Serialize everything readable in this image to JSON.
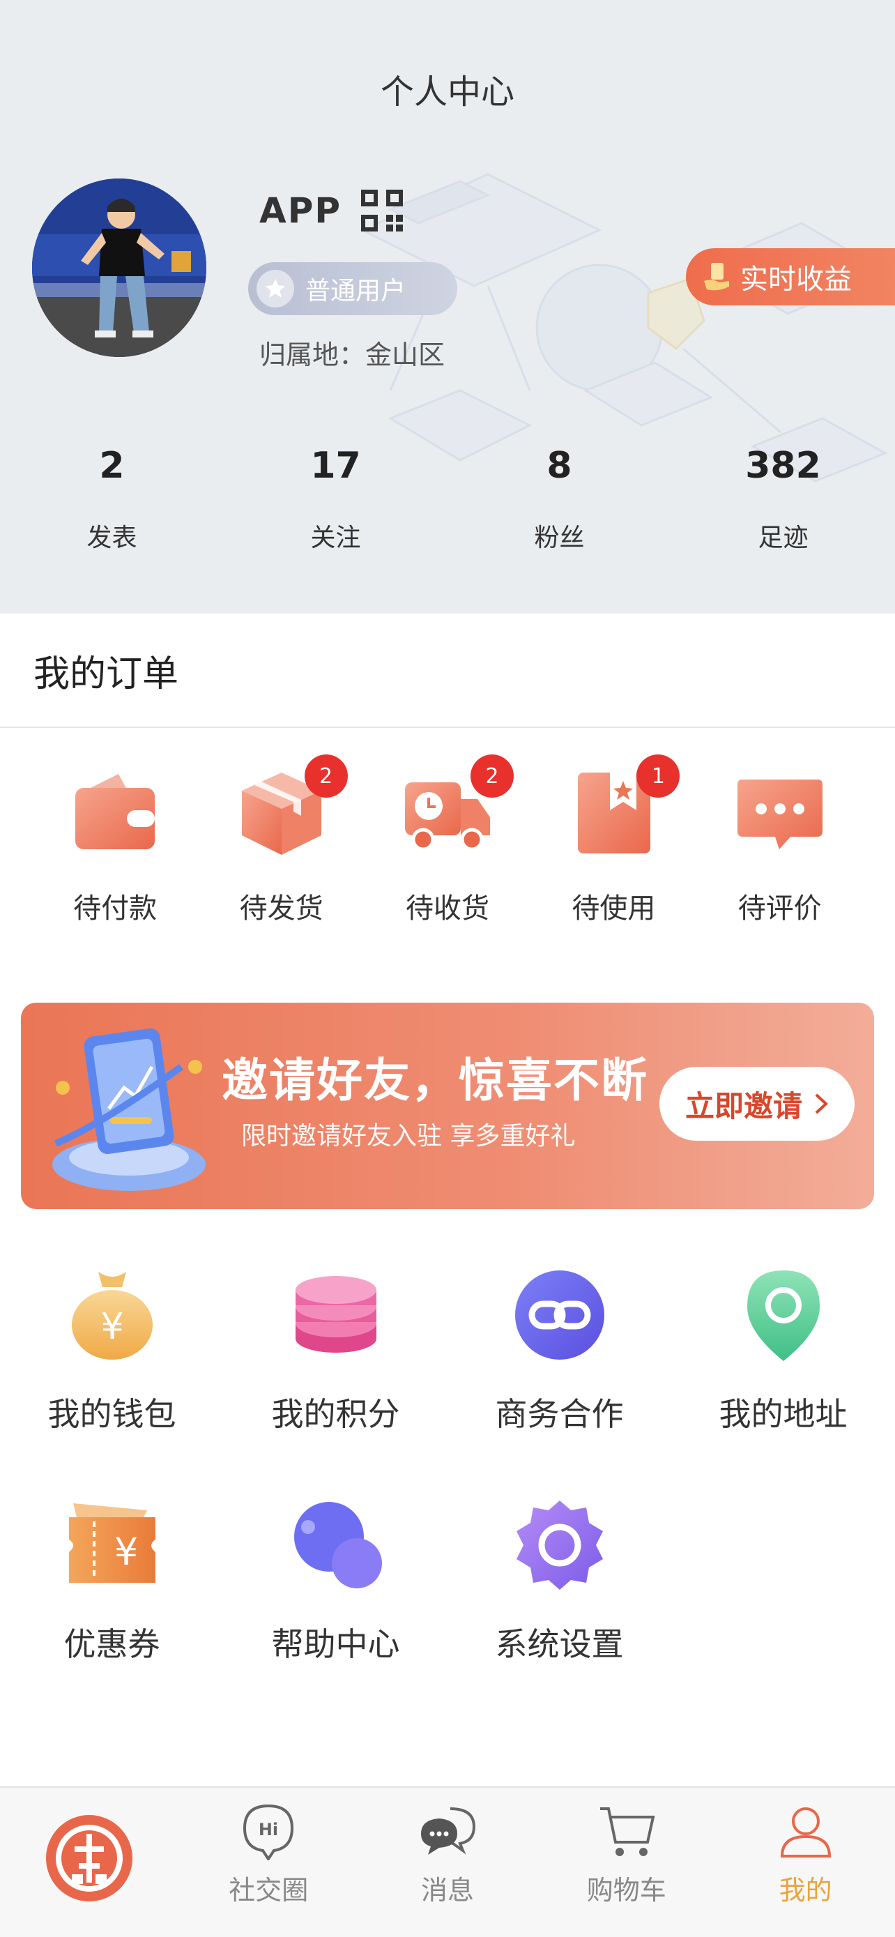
{
  "header": {
    "title": "个人中心",
    "app_name": "APP",
    "level": "普通用户",
    "location": "归属地：金山区",
    "earnings_label": "实时收益"
  },
  "stats": [
    {
      "value": "2",
      "label": "发表"
    },
    {
      "value": "17",
      "label": "关注"
    },
    {
      "value": "8",
      "label": "粉丝"
    },
    {
      "value": "382",
      "label": "足迹"
    }
  ],
  "orders": {
    "title": "我的订单",
    "items": [
      {
        "label": "待付款",
        "icon": "wallet-icon",
        "badge": ""
      },
      {
        "label": "待发货",
        "icon": "box-icon",
        "badge": "2"
      },
      {
        "label": "待收货",
        "icon": "truck-icon",
        "badge": "2"
      },
      {
        "label": "待使用",
        "icon": "bookmark-icon",
        "badge": "1"
      },
      {
        "label": "待评价",
        "icon": "chat-bubble-icon",
        "badge": ""
      }
    ]
  },
  "banner": {
    "title": "邀请好友，惊喜不断",
    "subtitle": "限时邀请好友入驻 享多重好礼",
    "button": "立即邀请"
  },
  "services": [
    {
      "label": "我的钱包",
      "icon": "money-bag-icon"
    },
    {
      "label": "我的积分",
      "icon": "coin-stack-icon"
    },
    {
      "label": "商务合作",
      "icon": "link-icon"
    },
    {
      "label": "我的地址",
      "icon": "location-pin-icon"
    },
    {
      "label": "优惠券",
      "icon": "coupon-icon"
    },
    {
      "label": "帮助中心",
      "icon": "help-bubbles-icon"
    },
    {
      "label": "系统设置",
      "icon": "settings-gear-icon"
    }
  ],
  "tabbar": {
    "active": "我的",
    "items": [
      {
        "label": "",
        "icon": "home-logo-icon"
      },
      {
        "label": "社交圈",
        "icon": "hi-bubble-icon"
      },
      {
        "label": "消息",
        "icon": "message-icon"
      },
      {
        "label": "购物车",
        "icon": "cart-icon"
      },
      {
        "label": "我的",
        "icon": "user-icon"
      }
    ]
  },
  "colors": {
    "accent_orange": "#ea7656",
    "badge_red": "#e8312c",
    "tab_active": "#e9a43f"
  }
}
